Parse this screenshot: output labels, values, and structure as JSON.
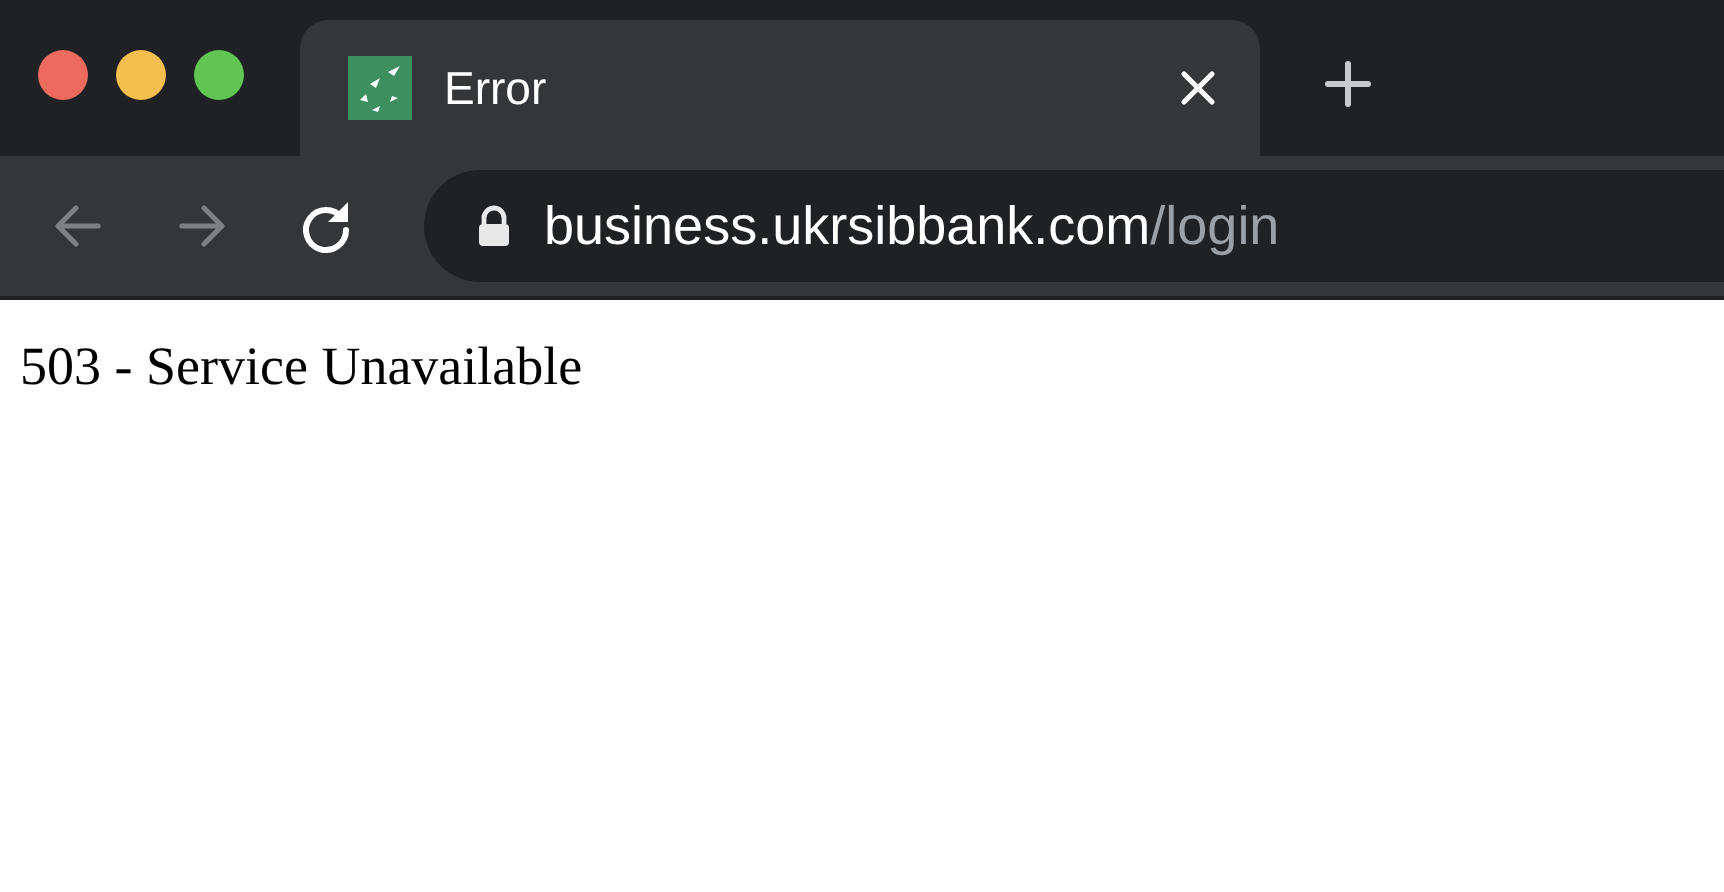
{
  "window": {
    "traffic_lights": [
      {
        "kind": "close"
      },
      {
        "kind": "minimize"
      },
      {
        "kind": "zoom"
      }
    ]
  },
  "tabs": [
    {
      "title": "Error",
      "selected": true
    }
  ],
  "toolbar": {
    "nav_buttons": [
      {
        "kind": "back",
        "disabled": true
      },
      {
        "kind": "forward",
        "disabled": true
      },
      {
        "kind": "reload",
        "disabled": false
      }
    ],
    "address": {
      "host": "business.ukrsibbank.com",
      "path": "/login"
    }
  },
  "page": {
    "message": "503 - Service Unavailable"
  }
}
